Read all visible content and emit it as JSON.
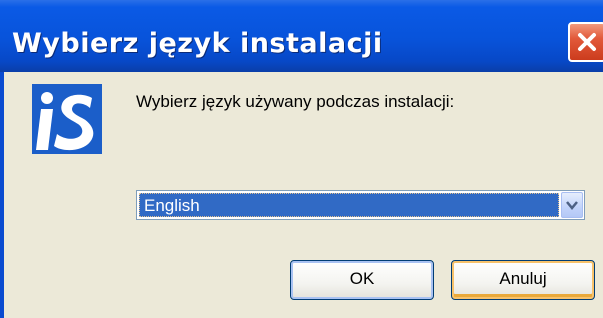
{
  "window": {
    "title": "Wybierz język instalacji"
  },
  "dialog": {
    "prompt": "Wybierz język używany podczas instalacji:",
    "language_select": {
      "selected": "English"
    },
    "buttons": {
      "ok_label": "OK",
      "cancel_label": "Anuluj"
    }
  },
  "icons": {
    "logo": "installer-logo-icon",
    "close": "close-icon",
    "dropdown": "chevron-down-icon"
  },
  "colors": {
    "titlebar": "#0853da",
    "close_button": "#e2593a",
    "selection": "#316ac5",
    "dialog_background": "#ece9d8",
    "logo": "#1b5ec9"
  }
}
